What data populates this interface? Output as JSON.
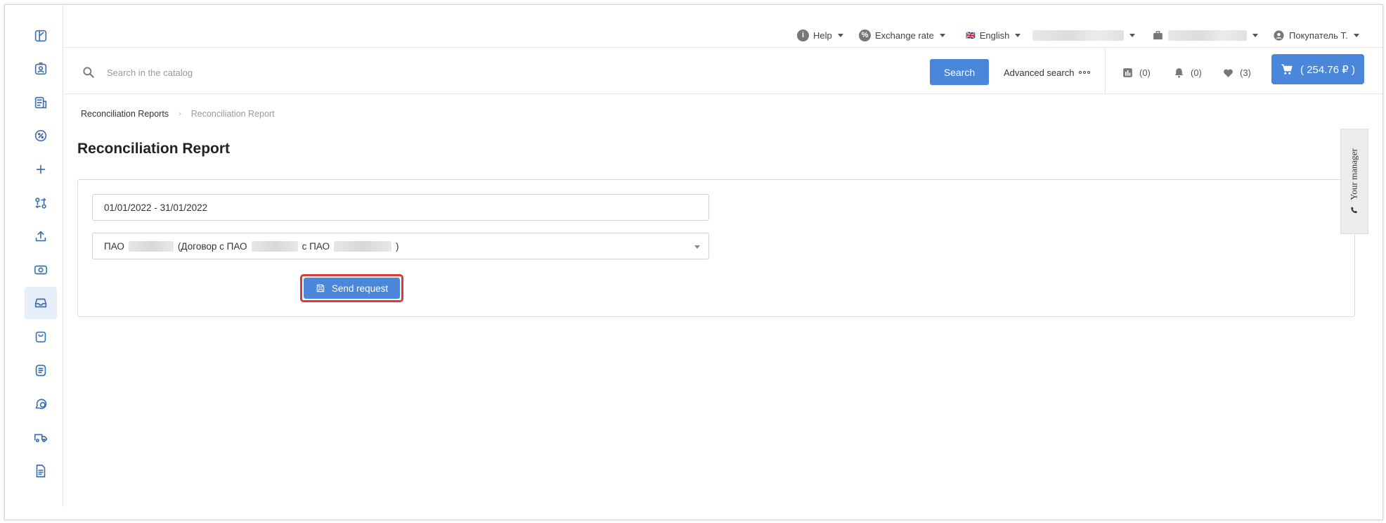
{
  "header": {
    "help_label": "Help",
    "exchange_label": "Exchange rate",
    "language_flag": "🇬🇧",
    "language_label": "English",
    "user_label": "Покупатель Т."
  },
  "search": {
    "placeholder": "Search in the catalog",
    "value": "",
    "button_label": "Search",
    "advanced_label": "Advanced search"
  },
  "counters": {
    "compare": "(0)",
    "notifications": "(0)",
    "favorites": "(3)"
  },
  "cart": {
    "label": "( 254.76 ₽ )"
  },
  "breadcrumb": {
    "parent": "Reconciliation Reports",
    "separator": "›",
    "current": "Reconciliation Report"
  },
  "page": {
    "title": "Reconciliation Report"
  },
  "form": {
    "date_range": "01/01/2022 - 31/01/2022",
    "contract": {
      "prefix": "ПАО",
      "part2": "(Договор с ПАО",
      "part3": "с ПАО",
      "suffix": ")"
    },
    "send_label": "Send request"
  },
  "manager_tab": {
    "label": "Your manager"
  },
  "colors": {
    "primary": "#4a86d9",
    "highlight_border": "#d93a3a",
    "sidebar_icon": "#3d6fb0",
    "sidebar_active_bg": "#e6eef9"
  },
  "sidebar": {
    "icons": [
      "catalog-icon",
      "profile-badge-icon",
      "documents-icon",
      "discount-icon",
      "plus-icon",
      "exchange-icon",
      "upload-icon",
      "payments-icon",
      "inbox-icon",
      "shopping-bag-icon",
      "orders-icon",
      "chat-icon",
      "delivery-truck-icon",
      "report-file-icon"
    ],
    "active_index": 8
  }
}
